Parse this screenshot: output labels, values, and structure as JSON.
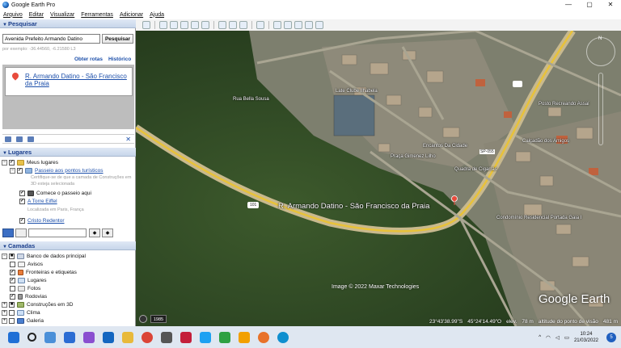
{
  "window": {
    "title": "Google Earth Pro",
    "controls": [
      "—",
      "▢",
      "✕"
    ]
  },
  "menu": [
    "Arquivo",
    "Editar",
    "Visualizar",
    "Ferramentas",
    "Adicionar",
    "Ajuda"
  ],
  "search": {
    "header": "Pesquisar",
    "value": "Avenida Prefeito Armando Datino",
    "button": "Pesquisar",
    "hint": "por exemplo: -36.44560, -6.21580 L3",
    "get_directions": "Obter rotas",
    "history": "Histórico",
    "result": "R. Armando Datino - São Francisco da Praia"
  },
  "places": {
    "header": "Lugares",
    "items": [
      {
        "label": "Meus lugares",
        "checked": true,
        "link": false
      },
      {
        "label": "Passeio aos pontos turísticos",
        "checked": true,
        "link": true
      },
      {
        "label": "Certifique-se de que a camada de Construções em 3D esteja selecionada",
        "note": true
      },
      {
        "label": "Comece o passeio aqui",
        "checked": true,
        "link": false
      },
      {
        "label": "A Torre Eiffel",
        "checked": true,
        "link": true
      },
      {
        "label": "Localizada em Paris, França",
        "note": true
      },
      {
        "label": "Cristo Redentor",
        "checked": true,
        "link": true
      }
    ]
  },
  "layers": {
    "header": "Camadas",
    "items": [
      {
        "label": "Banco de dados principal",
        "checked": true
      },
      {
        "label": "Avisos",
        "checked": false
      },
      {
        "label": "Fronteiras e etiquetas",
        "checked": true
      },
      {
        "label": "Lugares",
        "checked": true
      },
      {
        "label": "Fotos",
        "checked": false
      },
      {
        "label": "Rodovias",
        "checked": true
      },
      {
        "label": "Construções em 3D",
        "checked": true
      },
      {
        "label": "Clima",
        "checked": false
      },
      {
        "label": "Galeria",
        "checked": false
      }
    ]
  },
  "map": {
    "place_label": "R. Armando Datino - São Francisco da Praia",
    "labels": [
      "Rua Bella Sousa",
      "Late Clube Ilhabela",
      "Encantos Da Cidade",
      "Praça Gimenez Lilho",
      "SP-055",
      "Quadra de Cigarras",
      "Calçadão dos Amigos",
      "Condomínio Residencial Portada Gaia I",
      "Posto Recreando Assaí",
      "101"
    ],
    "copyright": "Image © 2022 Maxar Technologies",
    "logo": "Google Earth",
    "year": "1985",
    "status": {
      "lat": "23°43'38.99\"S",
      "lon": "45°24'14.49\"O",
      "elev_label": "elev.",
      "elev": "78 m",
      "eye_alt_label": "altitude do ponto de visão",
      "eye_alt": "481 m"
    }
  },
  "taskbar": {
    "time": "10:24",
    "date": "21/03/2022",
    "notifications": "5",
    "colors": [
      "#1f6fd6",
      "#222",
      "#4a8fd8",
      "#2b6cd3",
      "#8a4fd0",
      "#1466c0",
      "#4f7fd0",
      "#db4437",
      "#555",
      "#c41e3a",
      "#1da1f2",
      "#2ea043",
      "#f2a000",
      "#e8722a",
      "#0f8fcf"
    ]
  }
}
